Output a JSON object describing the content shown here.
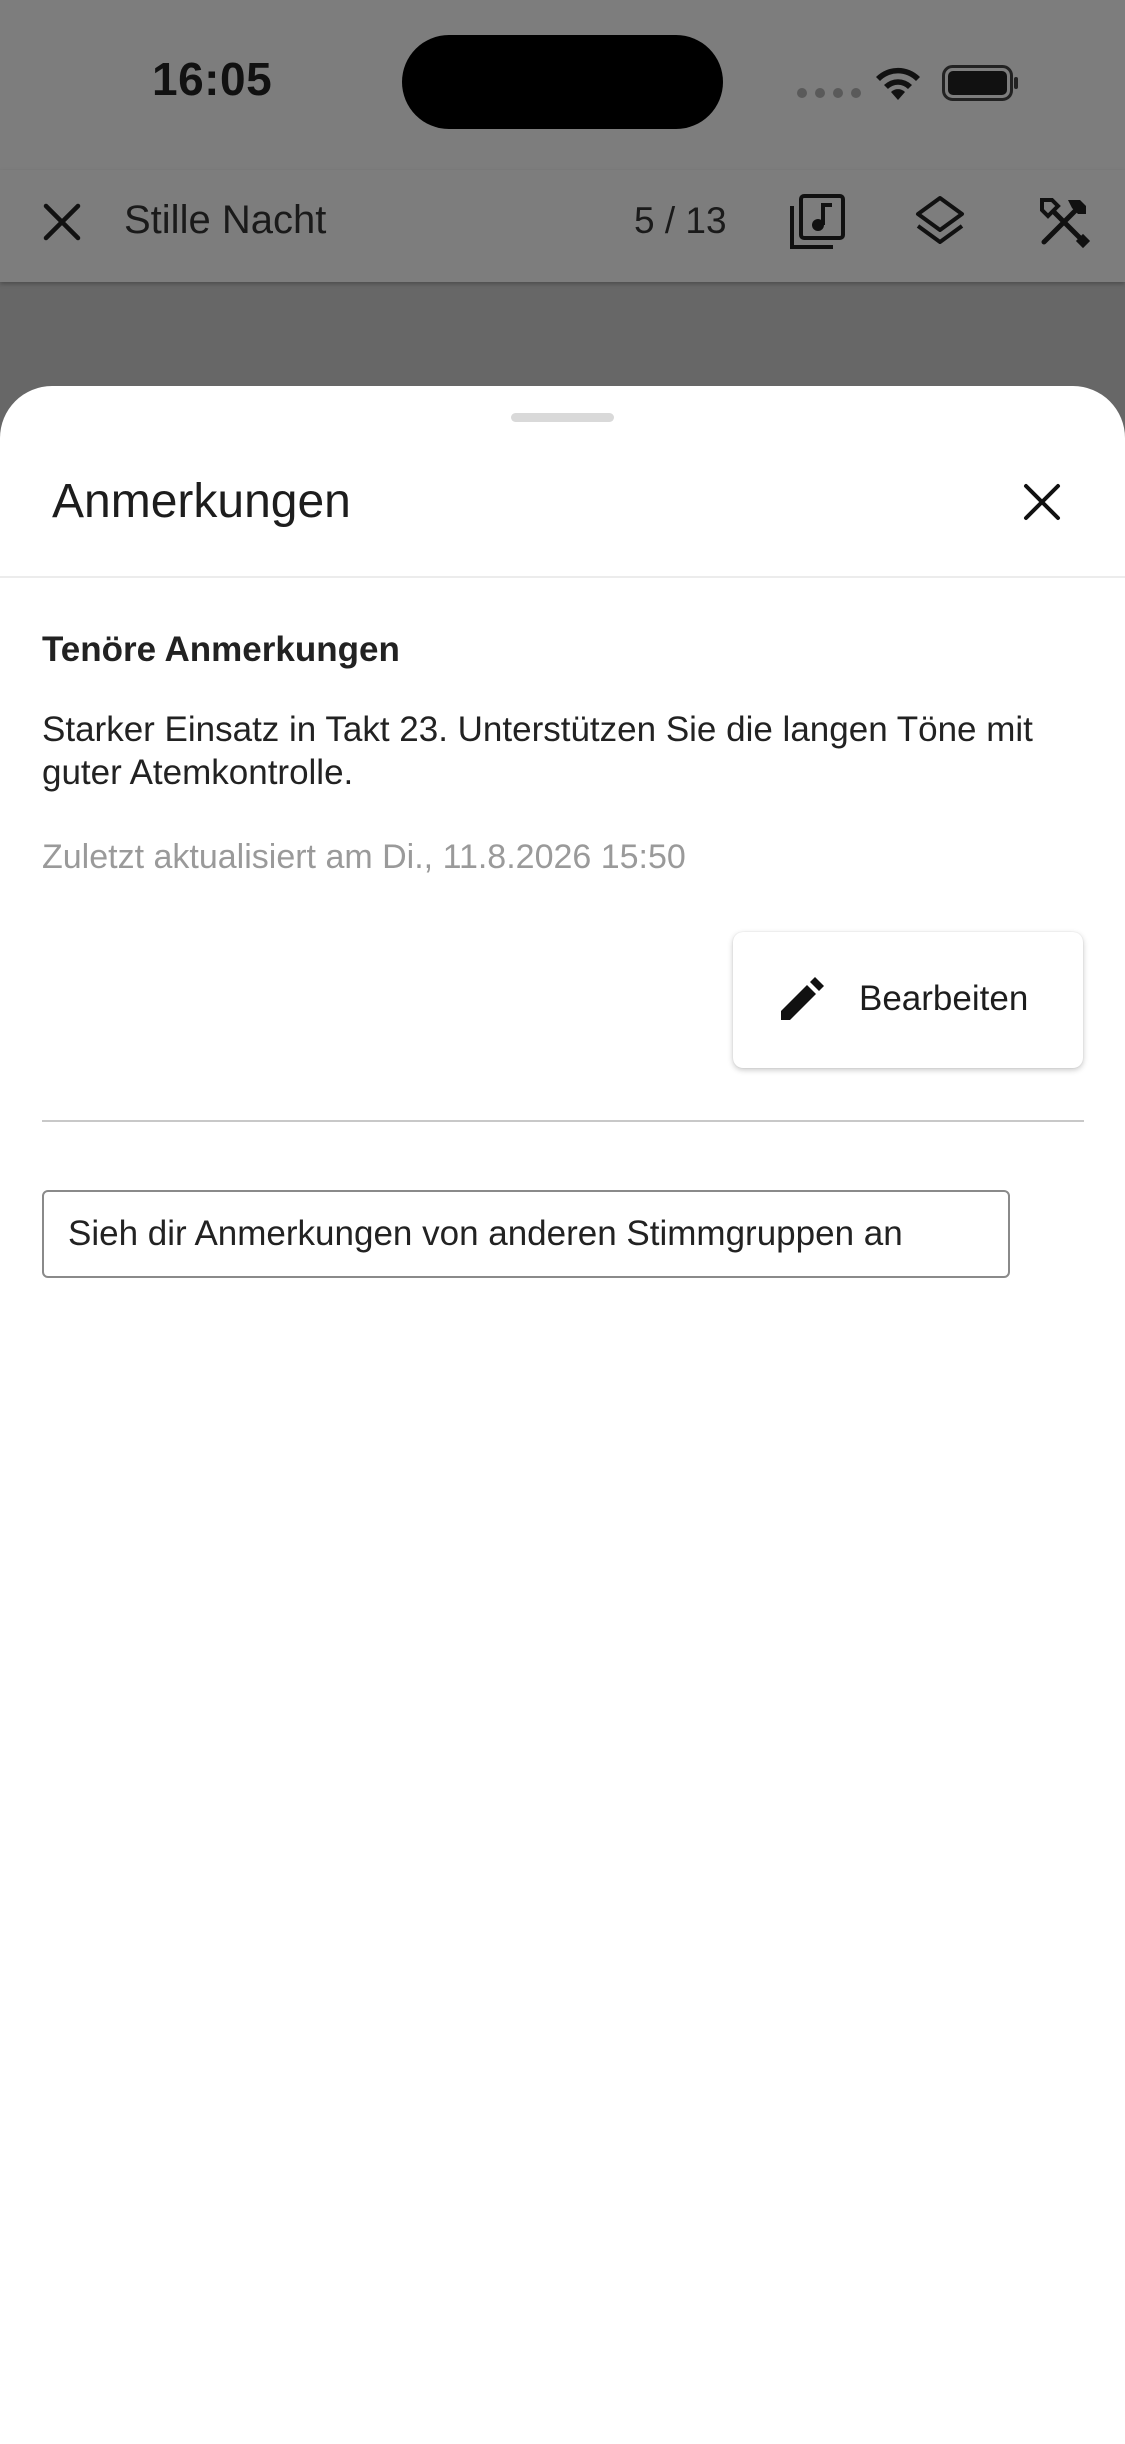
{
  "status_bar": {
    "time": "16:05"
  },
  "toolbar": {
    "title": "Stille Nacht",
    "page_indicator": "5 / 13",
    "icons": [
      "close-icon",
      "music-library-icon",
      "layers-icon",
      "tools-icon"
    ]
  },
  "sheet": {
    "title": "Anmerkungen",
    "section_heading": "Tenöre Anmerkungen",
    "annotation_text": "Starker Einsatz in Takt 23. Unterstützen Sie die langen Töne mit guter Atemkontrolle.",
    "updated_text": "Zuletzt aktualisiert am Di., 11.8.2026 15:50",
    "edit_label": "Bearbeiten",
    "other_voices_label": "Sieh dir Anmerkungen von anderen Stimmgruppen an"
  },
  "colors": {
    "backdrop": "#676767",
    "toolbar": "#7d7d7d",
    "sheet": "#ffffff",
    "muted_text": "#9a9a9a"
  }
}
